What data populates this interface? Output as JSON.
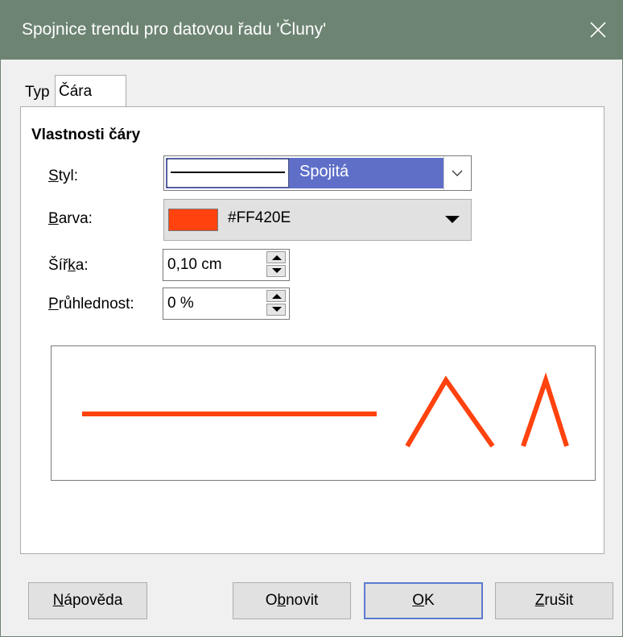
{
  "window": {
    "title": "Spojnice trendu pro datovou řadu 'Čluny'",
    "titlebar_color": "#6d8472"
  },
  "tabs": [
    {
      "label": "Typ",
      "active": false
    },
    {
      "label": "Čára",
      "active": true
    }
  ],
  "line_properties": {
    "heading": "Vlastnosti čáry",
    "style": {
      "label_accel": "S",
      "label_rest": "tyl:",
      "value": "Spojitá"
    },
    "color": {
      "label_accel": "B",
      "label_rest": "arva:",
      "value": "#FF420E",
      "swatch": "#FF420E"
    },
    "width": {
      "label_pre": "Šíř",
      "label_accel": "k",
      "label_rest": "a:",
      "value": "0,10 cm"
    },
    "transparency": {
      "label_accel": "P",
      "label_rest": "růhlednost:",
      "value": "0 %"
    }
  },
  "preview": {
    "line_color": "#FF420E"
  },
  "buttons": {
    "help": {
      "accel": "N",
      "rest": "ápověda"
    },
    "reset": {
      "pre": "O",
      "accel": "b",
      "rest": "novit"
    },
    "ok": {
      "accel": "O",
      "rest": "K"
    },
    "cancel": {
      "accel": "Z",
      "rest": "rušit"
    }
  },
  "icons": {
    "close": "close-icon",
    "dropdown": "chevron-down-icon",
    "spin_up": "arrow-up-icon",
    "spin_down": "arrow-down-icon"
  }
}
